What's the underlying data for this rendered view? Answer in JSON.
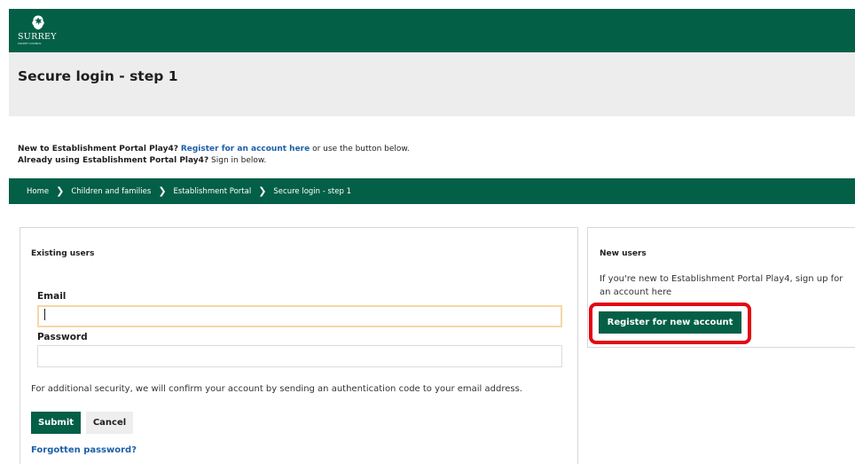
{
  "header": {
    "logo_text": "SURREY",
    "logo_subtext": "COUNTY COUNCIL",
    "bg_color": "#045f47"
  },
  "page": {
    "title": "Secure login - step 1"
  },
  "intro": {
    "line1_prefix": "New to Establishment Portal Play4?",
    "line1_link": "Register for an account here",
    "line1_suffix": "or use the button below.",
    "line2_prefix": "Already using Establishment Portal Play4?",
    "line2_suffix": "Sign in below."
  },
  "breadcrumb": {
    "items": [
      {
        "label": "Home"
      },
      {
        "label": "Children and families"
      },
      {
        "label": "Establishment Portal"
      },
      {
        "label": "Secure login - step 1"
      }
    ],
    "separator_icon": "chevron-right-icon"
  },
  "existing_users": {
    "heading": "Existing users",
    "email_label": "Email",
    "email_value": "",
    "password_label": "Password",
    "password_value": "",
    "security_note": "For additional security, we will confirm your account by sending an authentication code to your email address.",
    "submit_label": "Submit",
    "cancel_label": "Cancel",
    "forgot_label": "Forgotten password?"
  },
  "new_users": {
    "heading": "New users",
    "text": "If you're new to Establishment Portal Play4, sign up for an account here",
    "register_label": "Register for new account"
  },
  "colors": {
    "brand_green": "#045f47",
    "link_blue": "#1d5fa8",
    "highlight_red": "#e30613",
    "focus_border": "#f4d8a4"
  }
}
